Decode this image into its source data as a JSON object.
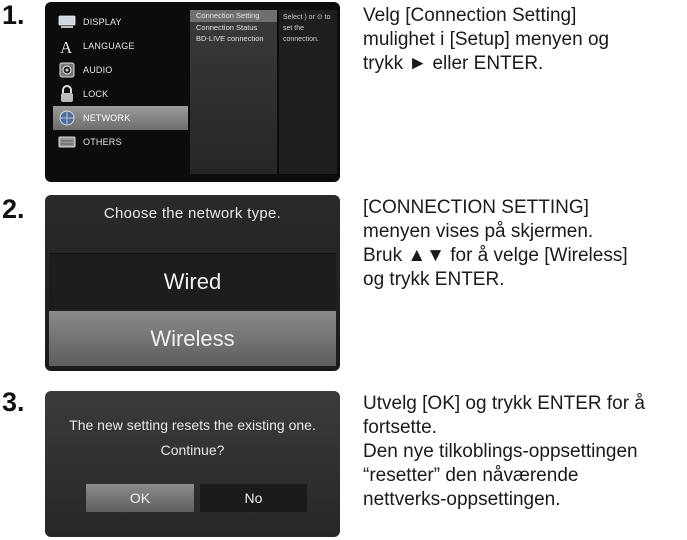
{
  "steps": [
    {
      "number": "1.",
      "text_lines": [
        "Velg [Connection Setting]",
        "mulighet i [Setup] menyen og",
        "trykk ► eller ENTER."
      ],
      "menu": {
        "items": [
          {
            "label": "DISPLAY",
            "icon": "display-icon"
          },
          {
            "label": "LANGUAGE",
            "icon": "language-icon"
          },
          {
            "label": "AUDIO",
            "icon": "audio-icon"
          },
          {
            "label": "LOCK",
            "icon": "lock-icon"
          },
          {
            "label": "NETWORK",
            "icon": "network-icon",
            "selected": true
          },
          {
            "label": "OTHERS",
            "icon": "others-icon"
          }
        ],
        "submenu": [
          "Connection Setting",
          "Connection Status",
          "BD-LIVE connection"
        ],
        "hint_lines": [
          "Select ) or ⊙ to",
          "set the connection."
        ]
      }
    },
    {
      "number": "2.",
      "text_lines": [
        "[CONNECTION SETTING]",
        "menyen vises på skjermen.",
        "Bruk ▲▼ for å velge [Wireless]",
        "og trykk ENTER."
      ],
      "dialog": {
        "title": "Choose the network type.",
        "options": [
          "Wired",
          "Wireless"
        ]
      }
    },
    {
      "number": "3.",
      "text_lines": [
        "Utvelg [OK] og trykk ENTER for å",
        "fortsette.",
        "Den nye tilkoblings-oppsettingen",
        "“resetter” den nåværende",
        "nettverks-oppsettingen."
      ],
      "dialog": {
        "message_lines": [
          "The new setting resets the existing one.",
          "Continue?"
        ],
        "buttons": [
          "OK",
          "No"
        ]
      }
    }
  ],
  "colors": {
    "selected_gradient_top": "#9a9a9a",
    "screen_background": "#0c0c0c"
  }
}
